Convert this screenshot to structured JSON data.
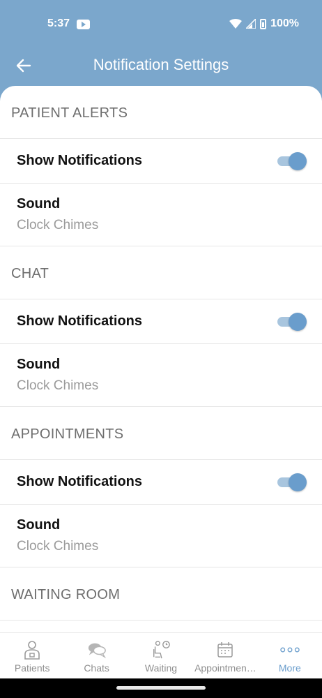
{
  "status_bar": {
    "time": "5:37",
    "battery": "100%"
  },
  "header": {
    "title": "Notification Settings"
  },
  "sections": [
    {
      "title": "PATIENT ALERTS",
      "show_label": "Show Notifications",
      "show_on": true,
      "sound_title": "Sound",
      "sound_value": "Clock Chimes"
    },
    {
      "title": "CHAT",
      "show_label": "Show Notifications",
      "show_on": true,
      "sound_title": "Sound",
      "sound_value": "Clock Chimes"
    },
    {
      "title": "APPOINTMENTS",
      "show_label": "Show Notifications",
      "show_on": true,
      "sound_title": "Sound",
      "sound_value": "Clock Chimes"
    },
    {
      "title": "WAITING ROOM"
    }
  ],
  "tabs": [
    {
      "label": "Patients",
      "icon": "patient-icon",
      "active": false
    },
    {
      "label": "Chats",
      "icon": "chat-icon",
      "active": false
    },
    {
      "label": "Waiting",
      "icon": "waiting-icon",
      "active": false
    },
    {
      "label": "Appointmen…",
      "icon": "calendar-icon",
      "active": false
    },
    {
      "label": "More",
      "icon": "more-icon",
      "active": true
    }
  ],
  "colors": {
    "primary": "#7ba7cc",
    "accent": "#6a9dcc"
  }
}
